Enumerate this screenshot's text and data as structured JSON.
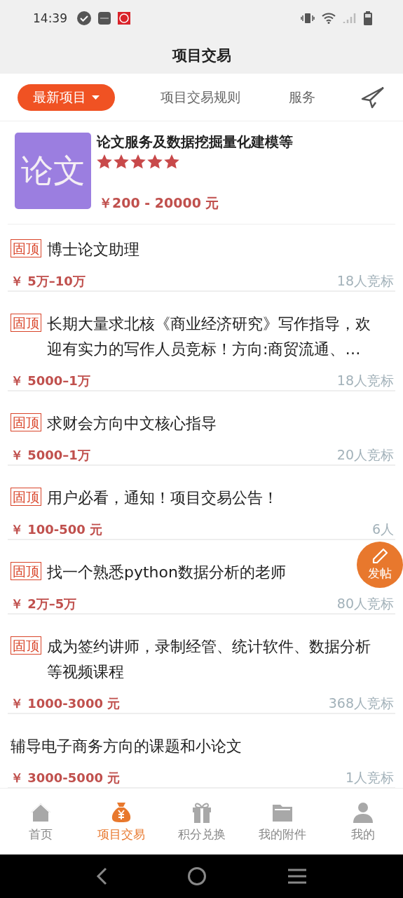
{
  "status_bar": {
    "time": "14:39"
  },
  "header": {
    "title": "项目交易"
  },
  "tabs": [
    {
      "label": "最新项目",
      "kind": "dropdown",
      "selected": true
    },
    {
      "label": "项目交易规则",
      "kind": "text",
      "selected": false
    },
    {
      "label": "服务",
      "kind": "text",
      "selected": false
    },
    {
      "kind": "send",
      "selected": false
    }
  ],
  "featured": {
    "logo": "论文",
    "title": "论文服务及数据挖掘量化建模等",
    "stars": 5,
    "price": "￥200 - 20000 元"
  },
  "projects": [
    {
      "pinned": true,
      "tag": "固顶",
      "title": "博士论文助理",
      "price": "￥ 5万–10万",
      "bids": "18人竞标"
    },
    {
      "pinned": true,
      "tag": "固顶",
      "title": "长期大量求北核《商业经济研究》写作指导，欢迎有实力的写作人员竞标！方向:商贸流通、…",
      "price": "￥ 5000–1万",
      "bids": "18人竞标"
    },
    {
      "pinned": true,
      "tag": "固顶",
      "title": "求财会方向中文核心指导",
      "price": "￥ 5000–1万",
      "bids": "20人竞标"
    },
    {
      "pinned": true,
      "tag": "固顶",
      "title": "用户必看，通知！项目交易公告！",
      "price": "￥ 100-500 元",
      "bids": "6人"
    },
    {
      "pinned": true,
      "tag": "固顶",
      "title": "找一个熟悉python数据分析的老师",
      "price": "￥ 2万–5万",
      "bids": "80人竞标"
    },
    {
      "pinned": true,
      "tag": "固顶",
      "title": "成为签约讲师，录制经管、统计软件、数据分析等视频课程",
      "price": "￥ 1000-3000 元",
      "bids": "368人竞标"
    },
    {
      "pinned": false,
      "title": "辅导电子商务方向的课题和小论文",
      "price": "￥ 3000-5000 元",
      "bids": "1人竞标"
    }
  ],
  "fab": {
    "label": "发帖"
  },
  "bottom_nav": [
    {
      "label": "首页",
      "kind": "home",
      "selected": false
    },
    {
      "label": "项目交易",
      "kind": "bag",
      "selected": true
    },
    {
      "label": "积分兑换",
      "kind": "gift",
      "selected": false
    },
    {
      "label": "我的附件",
      "kind": "folder",
      "selected": false
    },
    {
      "label": "我的",
      "kind": "user",
      "selected": false
    }
  ]
}
